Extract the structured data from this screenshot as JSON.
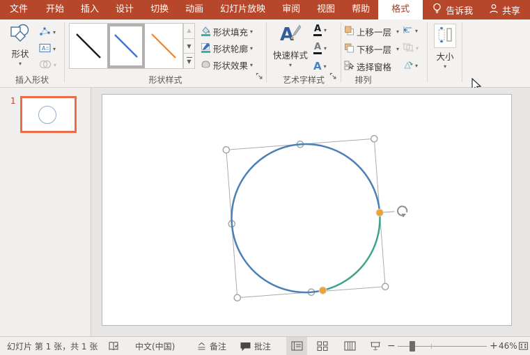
{
  "titlebar": {
    "tabs": [
      "文件",
      "开始",
      "插入",
      "设计",
      "切换",
      "动画",
      "幻灯片放映",
      "审阅",
      "视图",
      "帮助"
    ],
    "active_tab": "格式",
    "tell_me_label": "告诉我",
    "share_label": "共享",
    "bg_color": "#b7472a"
  },
  "ribbon": {
    "insert_shapes": {
      "group_label": "插入形状",
      "shapes_label": "形状"
    },
    "shape_styles": {
      "group_label": "形状样式",
      "fill_label": "形状填充",
      "outline_label": "形状轮廓",
      "effects_label": "形状效果",
      "style_colors": [
        "#1a1a1a",
        "#4472c4",
        "#ed7d31"
      ],
      "selected_style_index": 1
    },
    "wordart": {
      "group_label": "艺术字样式",
      "quick_styles_label": "快速样式"
    },
    "arrange": {
      "group_label": "排列",
      "bring_forward_label": "上移一层",
      "send_backward_label": "下移一层",
      "selection_pane_label": "选择窗格"
    },
    "size": {
      "label": "大小"
    }
  },
  "slides_panel": {
    "slide_number": "1",
    "selection_color": "#ed6c47"
  },
  "canvas": {
    "arc_blue": "#4a80b6",
    "arc_green": "#41a18c",
    "handle_orange": "#efa32e"
  },
  "statusbar": {
    "slide_info": "幻灯片 第 1 张，共 1 张",
    "language": "中文(中国)",
    "notes_label": "备注",
    "comments_label": "批注",
    "zoom_level": "46%"
  },
  "glyphs": {
    "dropdown": "▾",
    "scroll_up": "▲",
    "scroll_down": "▼",
    "zoom_out": "−",
    "zoom_in": "+",
    "wordart_a": "A"
  }
}
